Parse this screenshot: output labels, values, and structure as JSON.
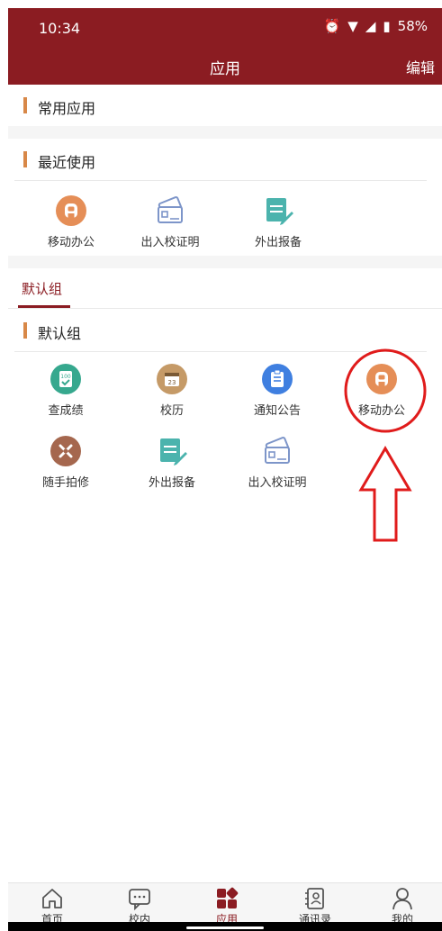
{
  "status": {
    "time": "10:34",
    "battery": "58%"
  },
  "header": {
    "title": "应用",
    "edit": "编辑"
  },
  "sections": {
    "common": "常用应用",
    "recent": "最近使用",
    "default_group": "默认组"
  },
  "tabs": {
    "default": "默认组"
  },
  "recent_apps": [
    {
      "label": "移动办公",
      "icon": "mobile-office-icon"
    },
    {
      "label": "出入校证明",
      "icon": "campus-pass-icon"
    },
    {
      "label": "外出报备",
      "icon": "outing-report-icon"
    }
  ],
  "group_apps": [
    {
      "label": "查成绩",
      "icon": "grades-icon"
    },
    {
      "label": "校历",
      "icon": "calendar-icon"
    },
    {
      "label": "通知公告",
      "icon": "notice-icon"
    },
    {
      "label": "移动办公",
      "icon": "mobile-office-icon"
    },
    {
      "label": "随手拍修",
      "icon": "repair-icon"
    },
    {
      "label": "外出报备",
      "icon": "outing-report-icon"
    },
    {
      "label": "出入校证明",
      "icon": "campus-pass-icon"
    }
  ],
  "bottom_nav": [
    {
      "label": "首页",
      "icon": "home-icon"
    },
    {
      "label": "校内",
      "icon": "chat-icon"
    },
    {
      "label": "应用",
      "icon": "apps-icon",
      "active": true
    },
    {
      "label": "通讯录",
      "icon": "contacts-icon"
    },
    {
      "label": "我的",
      "icon": "profile-icon"
    }
  ],
  "colors": {
    "brand": "#8b1c22",
    "accent_orange": "#e58e57"
  }
}
